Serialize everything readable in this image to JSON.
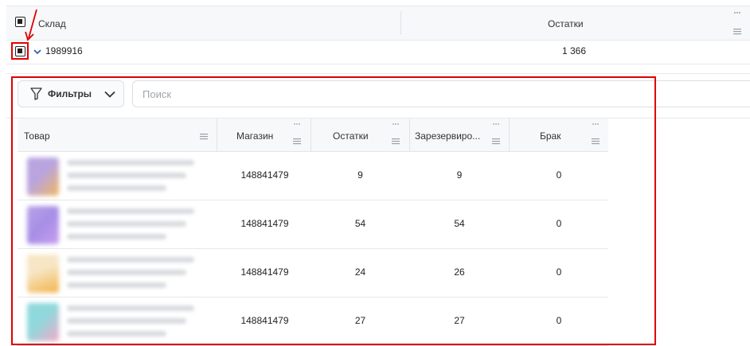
{
  "outer_table": {
    "columns": [
      "Склад",
      "Остатки"
    ],
    "row": {
      "id": "1989916",
      "stock": "1 366"
    }
  },
  "toolbar": {
    "filter_label": "Фильтры",
    "search_placeholder": "Поиск"
  },
  "inner_table": {
    "columns": [
      "Товар",
      "Магазин",
      "Остатки",
      "Зарезервиро...",
      "Брак"
    ],
    "rows": [
      {
        "store": "148841479",
        "stock": "9",
        "reserved": "9",
        "defect": "0",
        "thumb_color": "#b9a4e0",
        "thumb_color2": "#f0b860"
      },
      {
        "store": "148841479",
        "stock": "54",
        "reserved": "54",
        "defect": "0",
        "thumb_color": "#b8a2e8",
        "thumb_color2": "#c79ff0"
      },
      {
        "store": "148841479",
        "stock": "24",
        "reserved": "26",
        "defect": "0",
        "thumb_color": "#f7e6c5",
        "thumb_color2": "#f2b34a"
      },
      {
        "store": "148841479",
        "stock": "27",
        "reserved": "27",
        "defect": "0",
        "thumb_color": "#8fd8dc",
        "thumb_color2": "#f3a9c8"
      }
    ]
  },
  "colors": {
    "highlight": "#e00000",
    "header_bg": "#f7f8fa",
    "chevron": "#2a5ba8"
  }
}
